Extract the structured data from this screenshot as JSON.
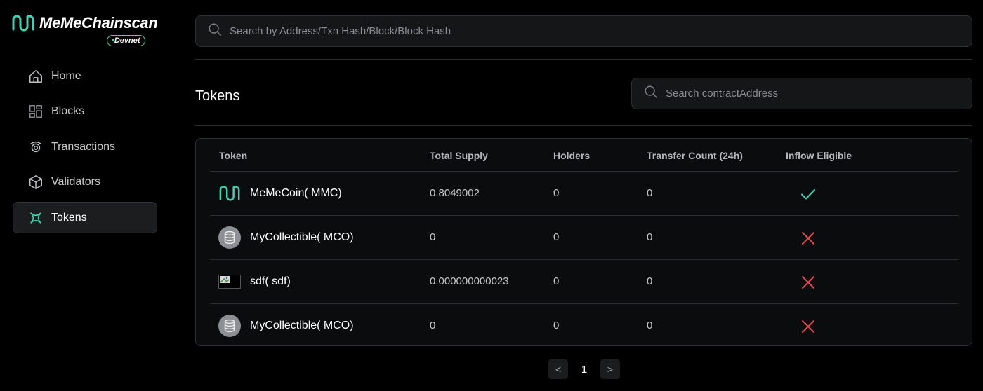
{
  "app": {
    "name": "MeMeChainscan",
    "network_badge": "Devnet",
    "brand_color": "#3fd5b4"
  },
  "sidebar": {
    "items": [
      {
        "label": "Home",
        "icon": "home-icon",
        "active": false
      },
      {
        "label": "Blocks",
        "icon": "blocks-icon",
        "active": false
      },
      {
        "label": "Transactions",
        "icon": "transactions-icon",
        "active": false
      },
      {
        "label": "Validators",
        "icon": "validators-icon",
        "active": false
      },
      {
        "label": "Tokens",
        "icon": "tokens-icon",
        "active": true
      }
    ]
  },
  "search": {
    "placeholder": "Search by Address/Txn Hash/Block/Block Hash",
    "value": ""
  },
  "tokens_page": {
    "title": "Tokens",
    "contract_search_placeholder": "Search contractAddress",
    "contract_search_value": ""
  },
  "table": {
    "headers": {
      "token": "Token",
      "total_supply": "Total Supply",
      "holders": "Holders",
      "transfer_count": "Transfer Count (24h)",
      "inflow_eligible": "Inflow Eligible"
    },
    "rows": [
      {
        "name": "MeMeCoin( MMC)",
        "icon": "memecoin-logo-icon",
        "total_supply": "0.8049002",
        "holders": "0",
        "transfer_count": "0",
        "inflow_eligible": true
      },
      {
        "name": "MyCollectible( MCO)",
        "icon": "database-token-icon",
        "total_supply": "0",
        "holders": "0",
        "transfer_count": "0",
        "inflow_eligible": false
      },
      {
        "name": "sdf( sdf)",
        "icon": "broken-image-icon",
        "total_supply": "0.000000000023",
        "holders": "0",
        "transfer_count": "0",
        "inflow_eligible": false
      },
      {
        "name": "MyCollectible( MCO)",
        "icon": "database-token-icon",
        "total_supply": "0",
        "holders": "0",
        "transfer_count": "0",
        "inflow_eligible": false
      }
    ],
    "eligible_color": "#3fd5b4",
    "not_eligible_color": "#e5484d"
  },
  "pagination": {
    "prev": "<",
    "current": "1",
    "next": ">"
  }
}
